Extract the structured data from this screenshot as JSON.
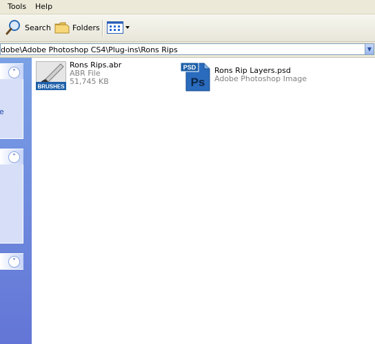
{
  "menu": {
    "tools": "Tools",
    "help": "Help"
  },
  "toolbar": {
    "search_label": "Search",
    "folders_label": "Folders"
  },
  "address": {
    "path": "dobe\\Adobe Photoshop CS4\\Plug-ins\\Rons Rips"
  },
  "taskpane": {
    "link_fragment": "e"
  },
  "files": [
    {
      "name": "Rons Rips.abr",
      "type": "ABR File",
      "size": "51,745 KB",
      "icon": "brushes-icon",
      "icon_text": "BRUSHES"
    },
    {
      "name": "Rons Rip Layers.psd",
      "type": "Adobe Photoshop Image",
      "icon": "photoshop-file-icon",
      "icon_badge": "PSD",
      "icon_text": "Ps"
    }
  ],
  "colors": {
    "taskpane": "#6f8be0",
    "link": "#2146b0",
    "ps_blue": "#1c5fa8"
  }
}
